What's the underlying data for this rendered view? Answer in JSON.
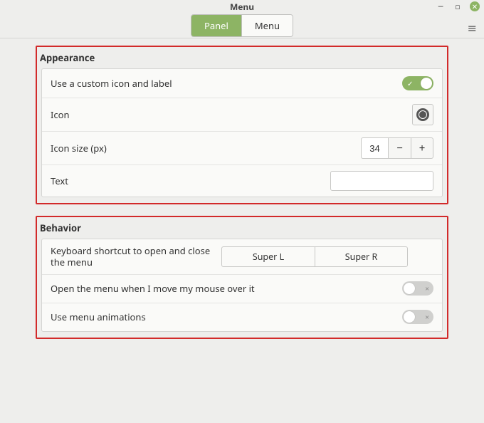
{
  "window": {
    "title": "Menu"
  },
  "tabs": {
    "panel": "Panel",
    "menu": "Menu",
    "active": "panel"
  },
  "appearance": {
    "heading": "Appearance",
    "custom_label": "Use a custom icon and label",
    "custom_enabled": true,
    "icon_label": "Icon",
    "size_label": "Icon size (px)",
    "size_value": "34",
    "text_label": "Text",
    "text_value": ""
  },
  "behavior": {
    "heading": "Behavior",
    "shortcut_label": "Keyboard shortcut to open and close the menu",
    "shortcut_a": "Super L",
    "shortcut_b": "Super R",
    "hover_label": "Open the menu when I move my mouse over it",
    "hover_enabled": false,
    "anim_label": "Use menu animations",
    "anim_enabled": false
  }
}
